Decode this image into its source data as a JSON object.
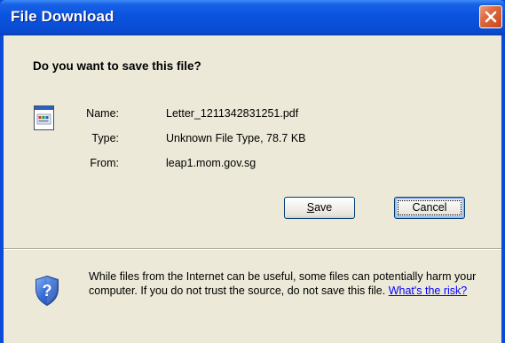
{
  "window": {
    "title": "File Download",
    "close_glyph": "close-icon"
  },
  "dialog": {
    "question": "Do you want to save this file?",
    "file_icon": "file-icon",
    "name_label": "Name:",
    "name_value": "Letter_1211342831251.pdf",
    "type_label": "Type:",
    "type_value": "Unknown File Type, 78.7 KB",
    "from_label": "From:",
    "from_value": "leap1.mom.gov.sg"
  },
  "buttons": {
    "save_prefix": "",
    "save_underlined": "S",
    "save_rest": "ave",
    "cancel_label": "Cancel"
  },
  "warning": {
    "icon": "shield-question-icon",
    "text": "While files from the Internet can be useful, some files can potentially harm your computer. If you do not trust the source, do not save this file. ",
    "link_text": "What's the risk?"
  },
  "colors": {
    "titlebar": "#0a4fd8",
    "client": "#ece9d8",
    "link": "#0000ff",
    "close": "#d4572c"
  }
}
